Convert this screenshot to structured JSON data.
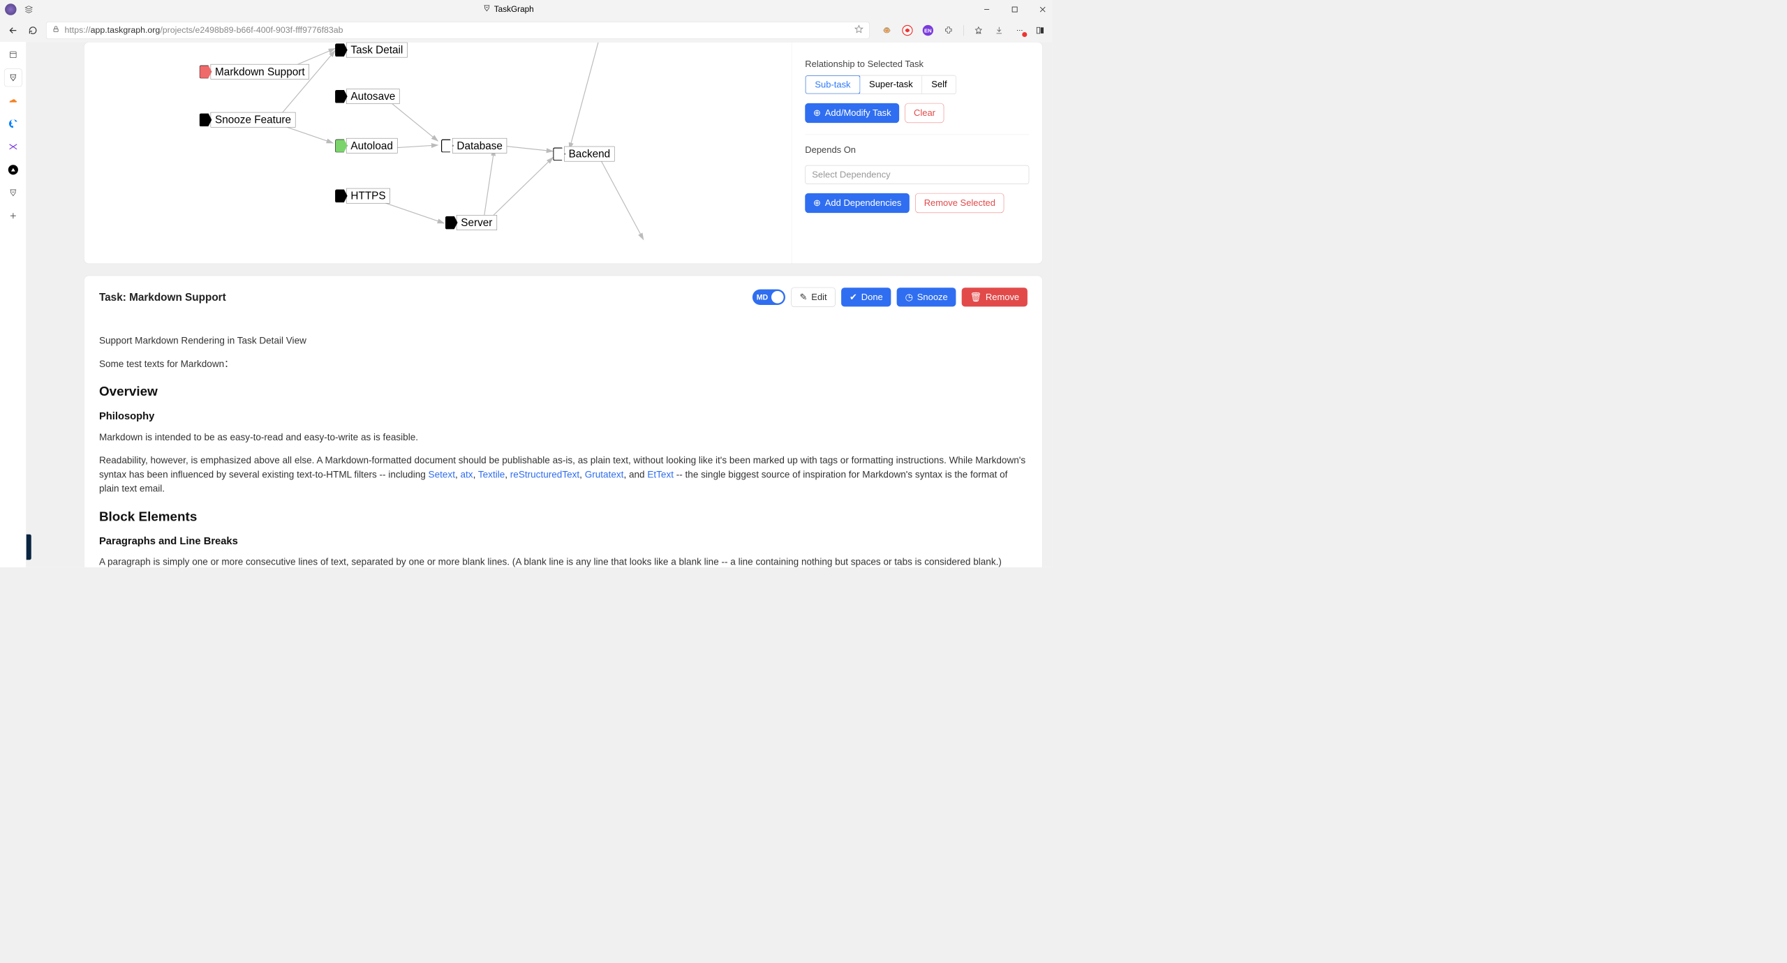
{
  "titlebar": {
    "title": "TaskGraph"
  },
  "addr": {
    "scheme": "https://",
    "host": "app.taskgraph.org",
    "path": "/projects/e2498b89-b66f-400f-903f-fff9776f83ab"
  },
  "graph": {
    "nodes": {
      "task_detail": "Task Detail",
      "markdown": "Markdown Support",
      "snooze": "Snooze Feature",
      "autosave": "Autosave",
      "autoload": "Autoload",
      "https": "HTTPS",
      "database": "Database",
      "server": "Server",
      "backend": "Backend"
    }
  },
  "rel_panel": {
    "label": "Relationship to Selected Task",
    "sub": "Sub-task",
    "super": "Super-task",
    "self": "Self",
    "add_modify": "Add/Modify Task",
    "clear": "Clear",
    "depends_on": "Depends On",
    "select_placeholder": "Select Dependency",
    "add_dep": "Add Dependencies",
    "remove_sel": "Remove Selected"
  },
  "detail": {
    "title": "Task: Markdown Support",
    "toggle": "MD",
    "edit": "Edit",
    "done": "Done",
    "snooze": "Snooze",
    "remove": "Remove",
    "intro1": "Support Markdown Rendering in Task Detail View",
    "intro2": "Some test texts for Markdown：",
    "h_overview": "Overview",
    "h_philosophy": "Philosophy",
    "p_philosophy": "Markdown is intended to be as easy-to-read and easy-to-write as is feasible.",
    "p_read1": "Readability, however, is emphasized above all else. A Markdown-formatted document should be publishable as-is, as plain text, without looking like it's been marked up with tags or formatting instructions. While Markdown's syntax has been influenced by several existing text-to-HTML filters -- including ",
    "links": {
      "setext": "Setext",
      "atx": "atx",
      "textile": "Textile",
      "rst": "reStructuredText",
      "gruta": "Grutatext",
      "ettext": "EtText"
    },
    "and": ", and ",
    "comma": ", ",
    "p_read2": " -- the single biggest source of inspiration for Markdown's syntax is the format of plain text email.",
    "h_block": "Block Elements",
    "h_para": "Paragraphs and Line Breaks",
    "p_para": "A paragraph is simply one or more consecutive lines of text, separated by one or more blank lines. (A blank line is any line that looks like a blank line -- a line containing nothing but spaces or tabs is considered blank.) Normal paragraphs should not be indented with spaces or tabs."
  }
}
